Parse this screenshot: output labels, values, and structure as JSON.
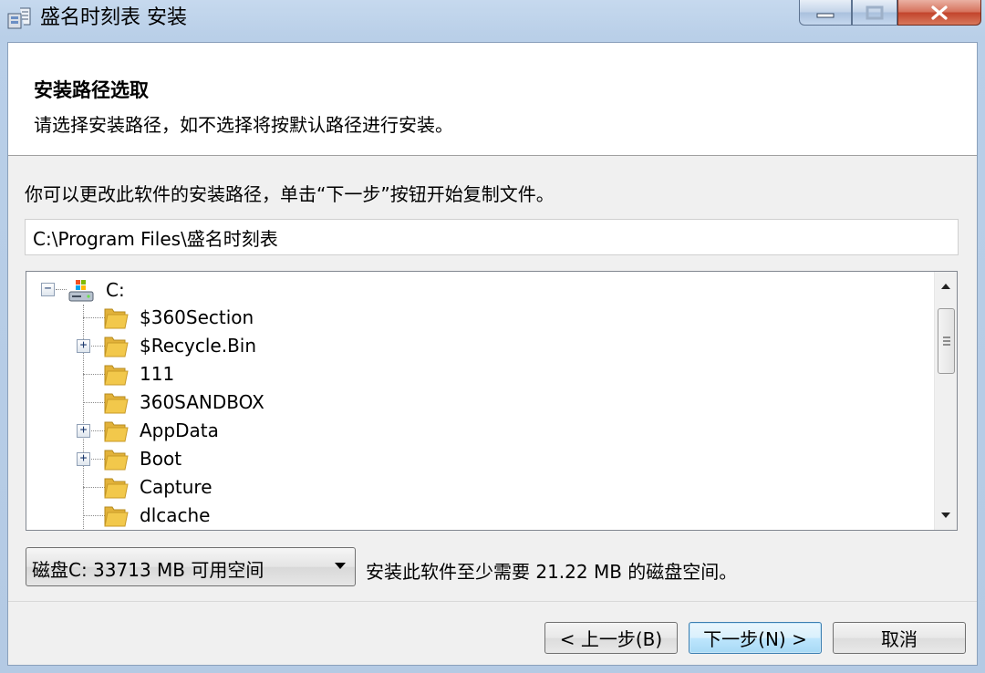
{
  "window": {
    "title": "盛名时刻表 安装"
  },
  "header": {
    "title": "安装路径选取",
    "subtitle": "请选择安装路径，如不选择将按默认路径进行安装。"
  },
  "main": {
    "instruction": "你可以更改此软件的安装路径，单击“下一步”按钮开始复制文件。",
    "install_path": "C:\\Program Files\\盛名时刻表",
    "tree": {
      "root": {
        "label": "C:",
        "expander": "−"
      },
      "items": [
        {
          "label": "$360Section",
          "has_children": false
        },
        {
          "label": "$Recycle.Bin",
          "has_children": true
        },
        {
          "label": "111",
          "has_children": false
        },
        {
          "label": "360SANDBOX",
          "has_children": false
        },
        {
          "label": "AppData",
          "has_children": true
        },
        {
          "label": "Boot",
          "has_children": true
        },
        {
          "label": "Capture",
          "has_children": false
        },
        {
          "label": "dlcache",
          "has_children": false
        }
      ]
    },
    "disk_select": {
      "selected": "磁盘C:   33713 MB 可用空间"
    },
    "space_required": "安装此软件至少需要 21.22 MB 的磁盘空间。"
  },
  "footer": {
    "prev_label": "< 上一步(B)",
    "next_label": "下一步(N) >",
    "cancel_label": "取消"
  },
  "icons": {
    "app": "installer-icon",
    "drive": "drive-icon",
    "folder": "folder-icon"
  },
  "colors": {
    "title_bar": "#b9cfe8",
    "close_button": "#c2432b",
    "folder": "#f2c84b",
    "default_button_border": "#3c7fb1"
  }
}
